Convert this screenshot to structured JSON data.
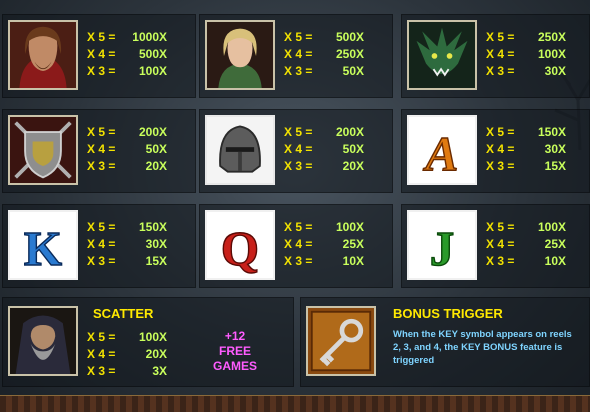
{
  "symbols": [
    {
      "name": "Knight",
      "pays": [
        {
          "count": "X 5 =",
          "value": "1000X"
        },
        {
          "count": "X 4 =",
          "value": "500X"
        },
        {
          "count": "X 3 =",
          "value": "100X"
        }
      ]
    },
    {
      "name": "Princess",
      "pays": [
        {
          "count": "X 5 =",
          "value": "500X"
        },
        {
          "count": "X 4 =",
          "value": "250X"
        },
        {
          "count": "X 3 =",
          "value": "50X"
        }
      ]
    },
    {
      "name": "Dragon",
      "pays": [
        {
          "count": "X 5 =",
          "value": "250X"
        },
        {
          "count": "X 4 =",
          "value": "100X"
        },
        {
          "count": "X 3 =",
          "value": "30X"
        }
      ]
    },
    {
      "name": "Shield",
      "pays": [
        {
          "count": "X 5 =",
          "value": "200X"
        },
        {
          "count": "X 4 =",
          "value": "50X"
        },
        {
          "count": "X 3 =",
          "value": "20X"
        }
      ]
    },
    {
      "name": "Helmet",
      "pays": [
        {
          "count": "X 5 =",
          "value": "200X"
        },
        {
          "count": "X 4 =",
          "value": "50X"
        },
        {
          "count": "X 3 =",
          "value": "20X"
        }
      ]
    },
    {
      "name": "A",
      "pays": [
        {
          "count": "X 5 =",
          "value": "150X"
        },
        {
          "count": "X 4 =",
          "value": "30X"
        },
        {
          "count": "X 3 =",
          "value": "15X"
        }
      ]
    },
    {
      "name": "K",
      "pays": [
        {
          "count": "X 5 =",
          "value": "150X"
        },
        {
          "count": "X 4 =",
          "value": "30X"
        },
        {
          "count": "X 3 =",
          "value": "15X"
        }
      ]
    },
    {
      "name": "Q",
      "pays": [
        {
          "count": "X 5 =",
          "value": "100X"
        },
        {
          "count": "X 4 =",
          "value": "25X"
        },
        {
          "count": "X 3 =",
          "value": "10X"
        }
      ]
    },
    {
      "name": "J",
      "pays": [
        {
          "count": "X 5 =",
          "value": "100X"
        },
        {
          "count": "X 4 =",
          "value": "25X"
        },
        {
          "count": "X 3 =",
          "value": "10X"
        }
      ]
    }
  ],
  "scatter": {
    "title": "SCATTER",
    "pays": [
      {
        "count": "X 5 =",
        "value": "100X"
      },
      {
        "count": "X 4 =",
        "value": "20X"
      },
      {
        "count": "X 3 =",
        "value": "3X"
      }
    ],
    "free_line1": "+12",
    "free_line2": "FREE",
    "free_line3": "GAMES"
  },
  "bonus": {
    "title": "BONUS TRIGGER",
    "description": "When the KEY symbol appears on reels 2, 3, and 4, the KEY BONUS feature is triggered"
  },
  "letter_glyphs": {
    "A": "A",
    "K": "K",
    "Q": "Q",
    "J": "J"
  }
}
